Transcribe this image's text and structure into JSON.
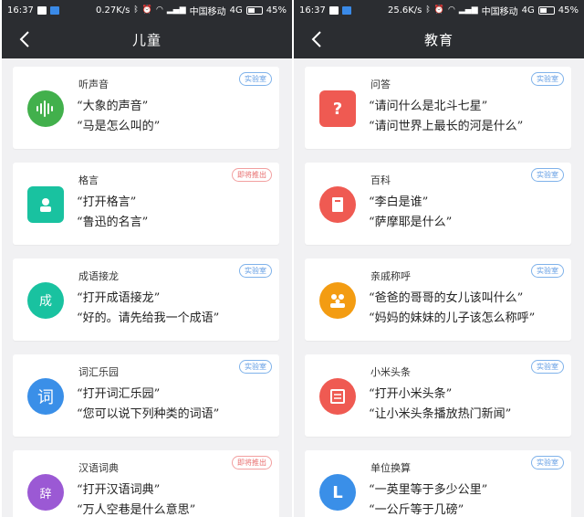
{
  "colors": {
    "header_bg": "#2b2d31",
    "page_bg": "#f1f1f3",
    "badge_lab": "#5f9be3",
    "badge_soon": "#e86e6e"
  },
  "left": {
    "status": {
      "time": "16:37",
      "speed": "0.27K/s",
      "carrier": "中国移动",
      "network": "4G",
      "battery": "45%"
    },
    "title": "儿童",
    "cards": [
      {
        "icon": "soundwave-icon",
        "icon_color": "#42b04c",
        "title": "听声音",
        "badge": "实验室",
        "badge_type": "lab",
        "line1": "“大象的声音”",
        "line2": "“马是怎么叫的”"
      },
      {
        "icon": "quote-person-icon",
        "icon_color": "#19c2a0",
        "title": "格言",
        "badge": "即将推出",
        "badge_type": "soon",
        "line1": "“打开格言”",
        "line2": "“鲁迅的名言”"
      },
      {
        "icon": "idiom-book-icon",
        "icon_color": "#19c2a0",
        "title": "成语接龙",
        "badge": "实验室",
        "badge_type": "lab",
        "line1": "“打开成语接龙”",
        "line2": "“好的。请先给我一个成语”",
        "glyph": "成"
      },
      {
        "icon": "word-icon",
        "icon_color": "#3a8fe8",
        "title": "词汇乐园",
        "badge": "实验室",
        "badge_type": "lab",
        "line1": "“打开词汇乐园”",
        "line2": "“您可以说下列种类的词语”",
        "glyph": "词"
      },
      {
        "icon": "dictionary-icon",
        "icon_color": "#9b59d4",
        "title": "汉语词典",
        "badge": "即将推出",
        "badge_type": "soon",
        "line1": "“打开汉语词典”",
        "line2": "“万人空巷是什么意思”",
        "glyph": "辞"
      }
    ]
  },
  "right": {
    "status": {
      "time": "16:37",
      "speed": "25.6K/s",
      "carrier": "中国移动",
      "network": "4G",
      "battery": "45%"
    },
    "title": "教育",
    "cards": [
      {
        "icon": "question-bubble-icon",
        "icon_color": "#ef5a52",
        "title": "问答",
        "badge": "实验室",
        "badge_type": "lab",
        "line1": "“请问什么是北斗七星”",
        "line2": "“请问世界上最长的河是什么”",
        "glyph": "?"
      },
      {
        "icon": "encyclopedia-icon",
        "icon_color": "#ef5a52",
        "title": "百科",
        "badge": "实验室",
        "badge_type": "lab",
        "line1": "“李白是谁”",
        "line2": "“萨摩耶是什么”"
      },
      {
        "icon": "family-icon",
        "icon_color": "#f39c12",
        "title": "亲戚称呼",
        "badge": "实验室",
        "badge_type": "lab",
        "line1": "“爸爸的哥哥的女儿该叫什么”",
        "line2": "“妈妈的妹妹的儿子该怎么称呼”"
      },
      {
        "icon": "newspaper-icon",
        "icon_color": "#ef5a52",
        "title": "小米头条",
        "badge": "实验室",
        "badge_type": "lab",
        "line1": "“打开小米头条”",
        "line2": "“让小米头条播放热门新闻”"
      },
      {
        "icon": "unit-convert-icon",
        "icon_color": "#3a8fe8",
        "title": "单位换算",
        "badge": "实验室",
        "badge_type": "lab",
        "line1": "“一英里等于多少公里”",
        "line2": "“一公斤等于几磅”",
        "glyph": "L"
      }
    ]
  }
}
